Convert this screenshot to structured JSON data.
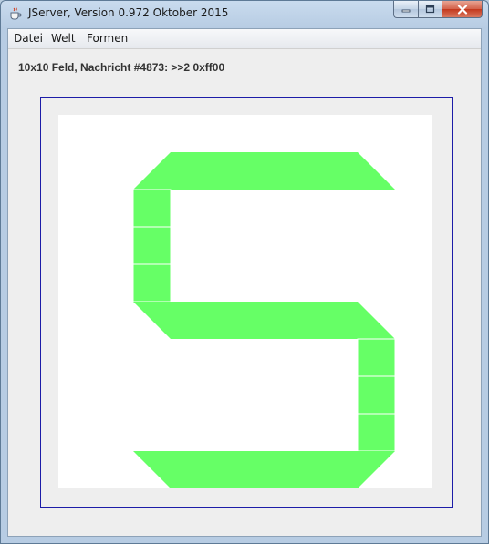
{
  "window": {
    "title": "JServer, Version 0.972 Oktober 2015",
    "icon": "java-cup-icon",
    "controls": [
      "minimize-icon",
      "maximize-icon",
      "close-icon"
    ]
  },
  "menu": {
    "items": [
      {
        "label": "Datei"
      },
      {
        "label": "Welt"
      },
      {
        "label": "Formen"
      }
    ]
  },
  "status": {
    "message": "10x10 Feld, Nachricht #4873: >>2 0xff00"
  },
  "board": {
    "cols": 10,
    "rows": 10,
    "fill_color": "#66ff66",
    "background_color": "#ffffff",
    "frame_color": "#1c1ca8",
    "shape": "seven-segment digit 5",
    "active_segments": [
      {
        "name": "top",
        "orientation": "horizontal",
        "row": 1,
        "col_start": 2,
        "col_end": 8
      },
      {
        "name": "upper-left",
        "orientation": "vertical",
        "col": 2,
        "row_start": 2,
        "row_end": 4
      },
      {
        "name": "middle",
        "orientation": "horizontal",
        "row": 5,
        "col_start": 2,
        "col_end": 8
      },
      {
        "name": "lower-right",
        "orientation": "vertical",
        "col": 8,
        "row_start": 6,
        "row_end": 8
      },
      {
        "name": "bottom",
        "orientation": "horizontal",
        "row": 9,
        "col_start": 2,
        "col_end": 8
      }
    ]
  }
}
